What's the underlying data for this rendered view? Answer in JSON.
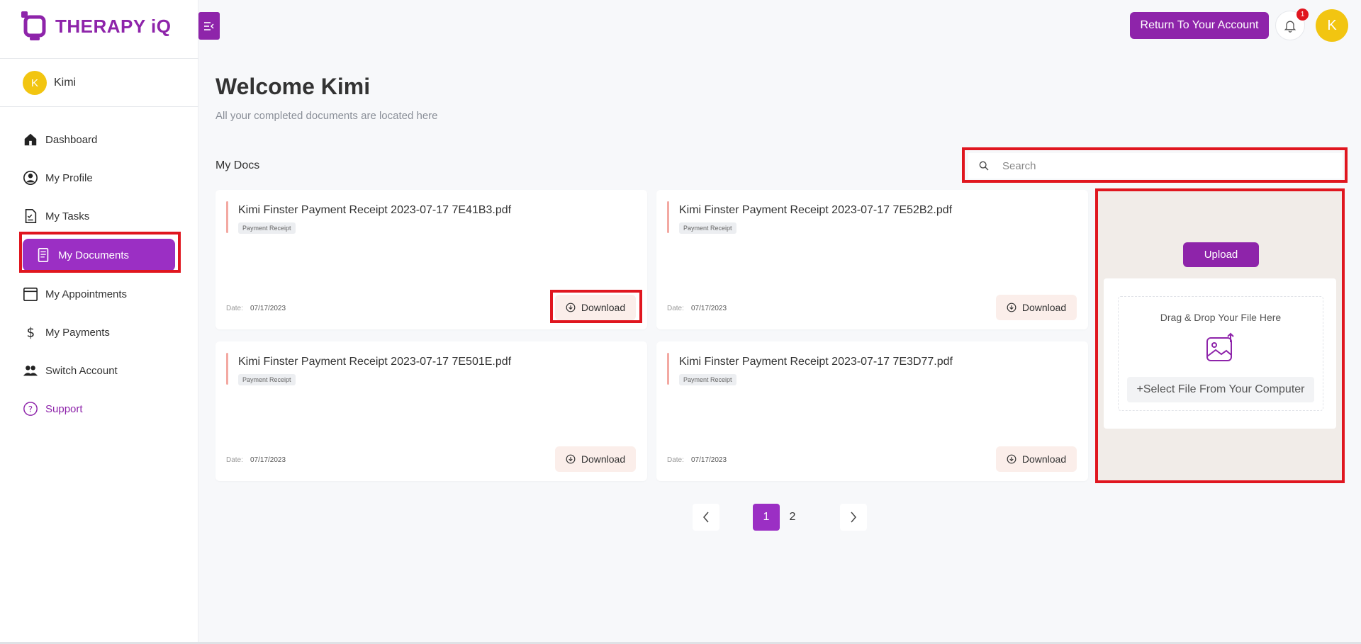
{
  "brand": {
    "name": "THERAPY iQ",
    "color": "#8e24aa"
  },
  "user": {
    "initial": "K",
    "name": "Kimi"
  },
  "sidebar": {
    "items": [
      {
        "label": "Dashboard",
        "icon": "home-icon"
      },
      {
        "label": "My Profile",
        "icon": "user-circle-icon"
      },
      {
        "label": "My Tasks",
        "icon": "task-doc-icon"
      },
      {
        "label": "My Documents",
        "icon": "document-icon",
        "active": true
      },
      {
        "label": "My Appointments",
        "icon": "calendar-icon"
      },
      {
        "label": "My Payments",
        "icon": "dollar-icon"
      },
      {
        "label": "Switch Account",
        "icon": "users-icon"
      },
      {
        "label": "Support",
        "icon": "help-circle-icon"
      }
    ]
  },
  "header": {
    "return_label": "Return To Your Account",
    "notification_count": "1",
    "avatar_initial": "K"
  },
  "main": {
    "welcome_prefix": "Welcome",
    "welcome_name": "Kimi",
    "subtitle": "All your completed documents are located here",
    "section_title": "My Docs",
    "search_placeholder": "Search"
  },
  "documents": [
    {
      "title": "Kimi Finster Payment Receipt 2023-07-17 7E41B3.pdf",
      "tag": "Payment Receipt",
      "date_label": "Date:",
      "date": "07/17/2023",
      "download_label": "Download"
    },
    {
      "title": "Kimi Finster Payment Receipt 2023-07-17 7E52B2.pdf",
      "tag": "Payment Receipt",
      "date_label": "Date:",
      "date": "07/17/2023",
      "download_label": "Download"
    },
    {
      "title": "Kimi Finster Payment Receipt 2023-07-17 7E501E.pdf",
      "tag": "Payment Receipt",
      "date_label": "Date:",
      "date": "07/17/2023",
      "download_label": "Download"
    },
    {
      "title": "Kimi Finster Payment Receipt 2023-07-17 7E3D77.pdf",
      "tag": "Payment Receipt",
      "date_label": "Date:",
      "date": "07/17/2023",
      "download_label": "Download"
    }
  ],
  "upload": {
    "button_label": "Upload",
    "drop_text": "Drag & Drop Your File Here",
    "select_label": "+Select File From Your Computer"
  },
  "pagination": {
    "pages": [
      "1",
      "2"
    ],
    "current": "1"
  },
  "colors": {
    "accent": "#8e24aa",
    "active_nav": "#9b2fc4",
    "highlight": "#e0161f",
    "avatar": "#f2c511"
  }
}
